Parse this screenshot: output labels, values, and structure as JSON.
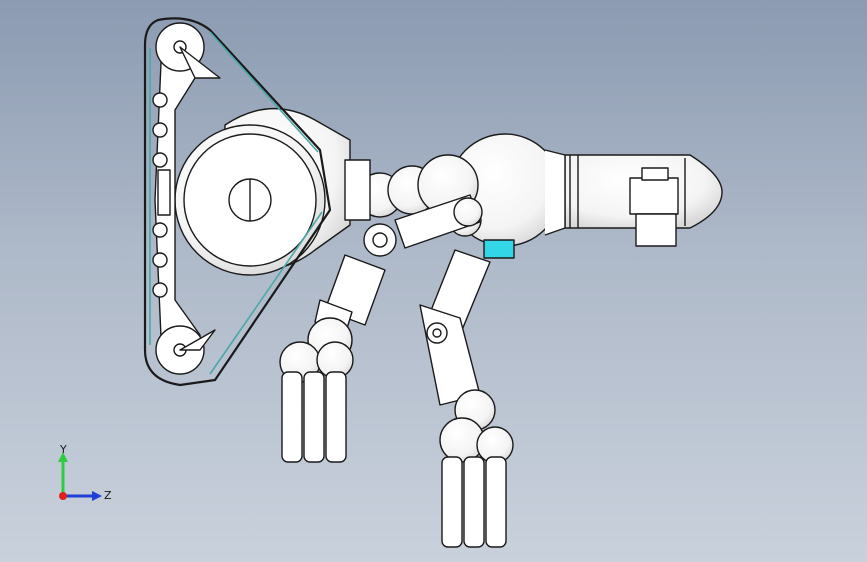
{
  "viewport": {
    "background_top": "#8c9bb2",
    "background_bottom": "#c9d1dc"
  },
  "model": {
    "body_color": "#ffffff",
    "outline_color": "#1a1a1a",
    "accent_part_color": "#33d6e6",
    "belt_color": "#4aa8a8"
  },
  "triad": {
    "y_label": "Y",
    "z_label": "Z",
    "y_color": "#2ecc40",
    "z_color": "#1f3fd6",
    "x_color": "#e0201b"
  }
}
